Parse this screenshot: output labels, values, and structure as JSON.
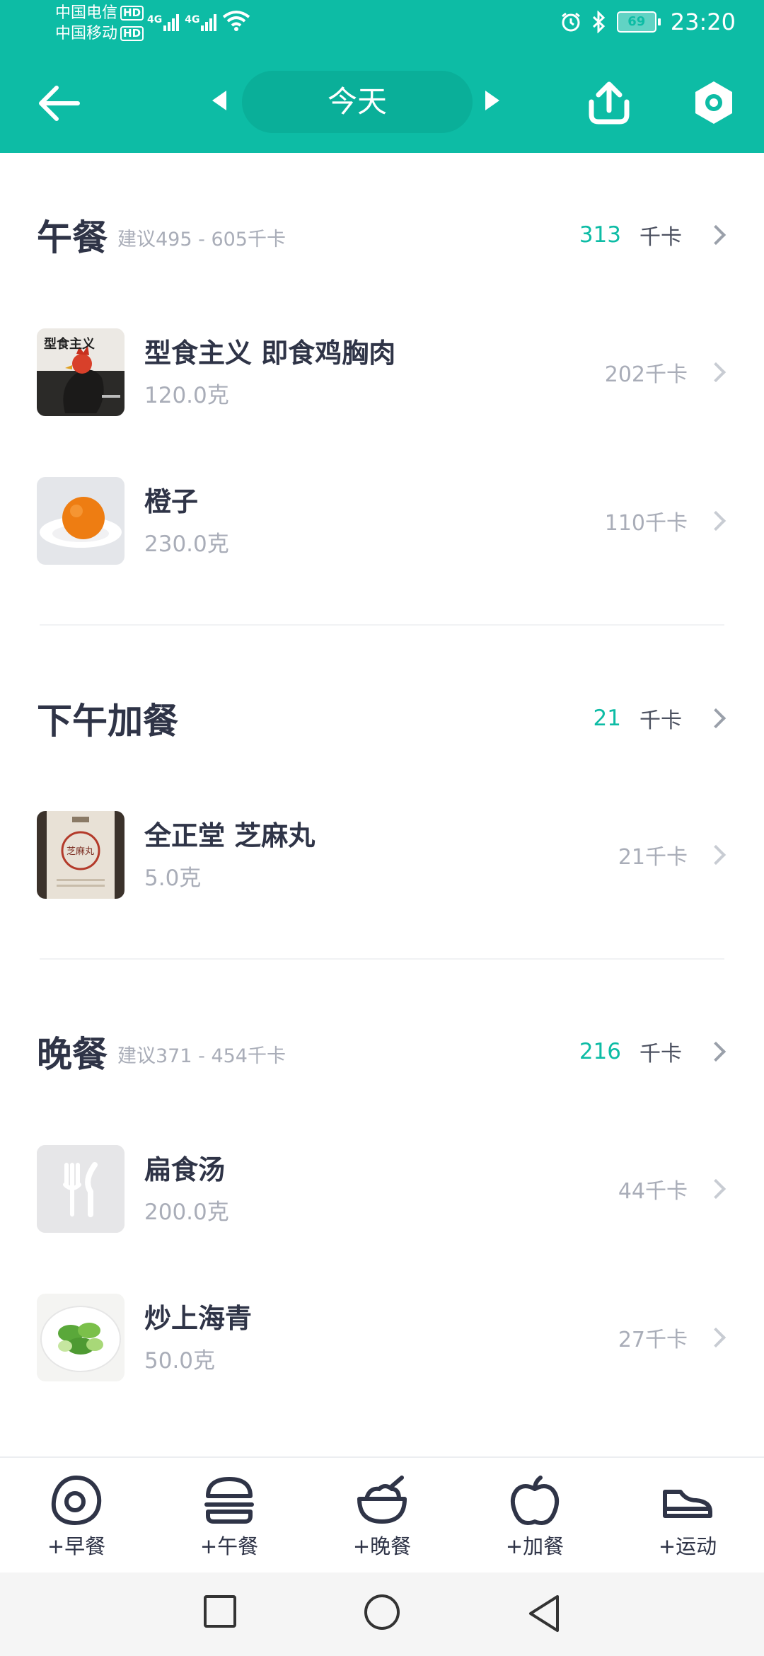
{
  "status_bar": {
    "carrier1": "中国电信",
    "carrier2": "中国移动",
    "hd": "HD",
    "net1": "4G",
    "net2": "4G",
    "battery": "69",
    "time": "23:20"
  },
  "header": {
    "date_label": "今天"
  },
  "sections": [
    {
      "title": "午餐",
      "advice": "建议495 - 605千卡",
      "total": "313",
      "unit": "千卡",
      "items": [
        {
          "name": "型食主义 即食鸡胸肉",
          "amount": "120.0克",
          "kcal": "202千卡",
          "thumb_text": "型食主义"
        },
        {
          "name": "橙子",
          "amount": "230.0克",
          "kcal": "110千卡"
        }
      ]
    },
    {
      "title": "下午加餐",
      "advice": "",
      "total": "21",
      "unit": "千卡",
      "items": [
        {
          "name": "全正堂 芝麻丸",
          "amount": "5.0克",
          "kcal": "21千卡",
          "thumb_text": "芝麻丸"
        }
      ]
    },
    {
      "title": "晚餐",
      "advice": "建议371 - 454千卡",
      "total": "216",
      "unit": "千卡",
      "items": [
        {
          "name": "扁食汤",
          "amount": "200.0克",
          "kcal": "44千卡"
        },
        {
          "name": "炒上海青",
          "amount": "50.0克",
          "kcal": "27千卡"
        }
      ]
    }
  ],
  "actions": [
    {
      "label": "+早餐",
      "icon": "egg-icon"
    },
    {
      "label": "+午餐",
      "icon": "burger-icon"
    },
    {
      "label": "+晚餐",
      "icon": "rice-bowl-icon"
    },
    {
      "label": "+加餐",
      "icon": "apple-icon"
    },
    {
      "label": "+运动",
      "icon": "sneaker-icon"
    }
  ],
  "colors": {
    "brand": "#0dbca5",
    "title_text": "#2f3447",
    "muted_text": "#a9adb8"
  }
}
